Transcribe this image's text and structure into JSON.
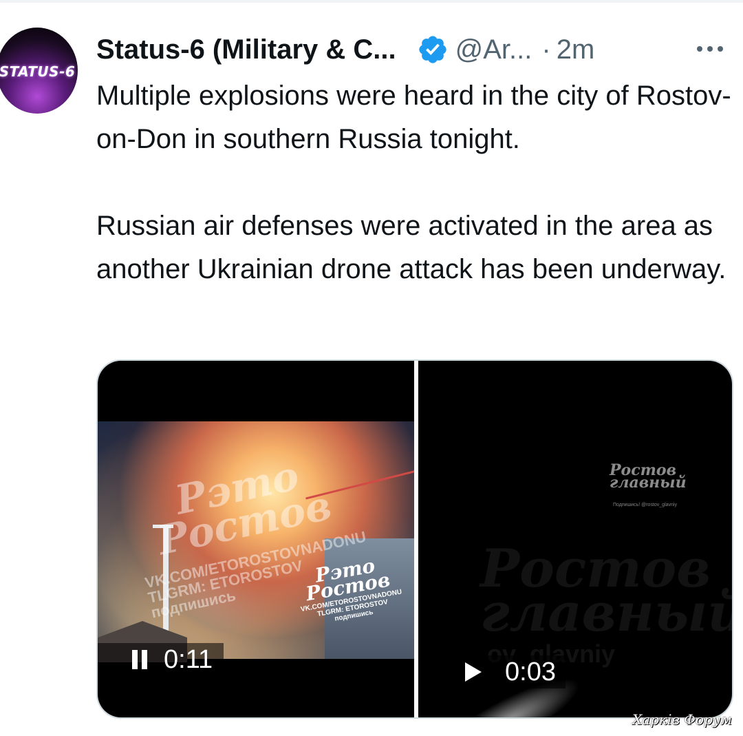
{
  "tweet": {
    "avatar_text": "STATUS-6",
    "display_name": "Status-6 (Military & C...",
    "verified_icon": "verified-badge-icon",
    "handle": "@Ar...",
    "separator": "·",
    "time": "2m",
    "more_icon": "more-options-icon",
    "paragraphs": [
      "Multiple explosions were heard in the city of Rostov-on-Don in southern Russia tonight.",
      "Russian air defenses were activated in the area as another Ukrainian drone attack has been underway."
    ]
  },
  "media": {
    "videos": [
      {
        "state_icon": "pause-icon",
        "timer": "0:11",
        "watermark": {
          "big_line1": "Рэто",
          "big_line2": "Ростов",
          "sub_line1": "VK.COM/ETOROSTOVNADONU",
          "sub_line2": "TLGRM: ETOROSTOV",
          "sub_line3": "подпишись",
          "small_line1": "Рэто",
          "small_line2": "Ростов",
          "small_sub1": "VK.COM/ETOROSTOVNADONU",
          "small_sub2": "TLGRM: ETOROSTOV",
          "small_sub3": "подпишись"
        }
      },
      {
        "state_icon": "play-icon",
        "timer": "0:03",
        "watermark": {
          "logo_line1": "Ростов",
          "logo_line2": "главный",
          "logo_sub": "Подпишись! @rostov_glavniy",
          "big_line1": "Ростов",
          "big_line2": "главный",
          "big_sub": "ov_glavniy"
        }
      }
    ],
    "corner_watermark": "Харків Форум"
  },
  "colors": {
    "text_primary": "#0f1419",
    "text_secondary": "#536471",
    "verified_blue": "#1d9bf0",
    "media_border": "#cfd9de"
  }
}
